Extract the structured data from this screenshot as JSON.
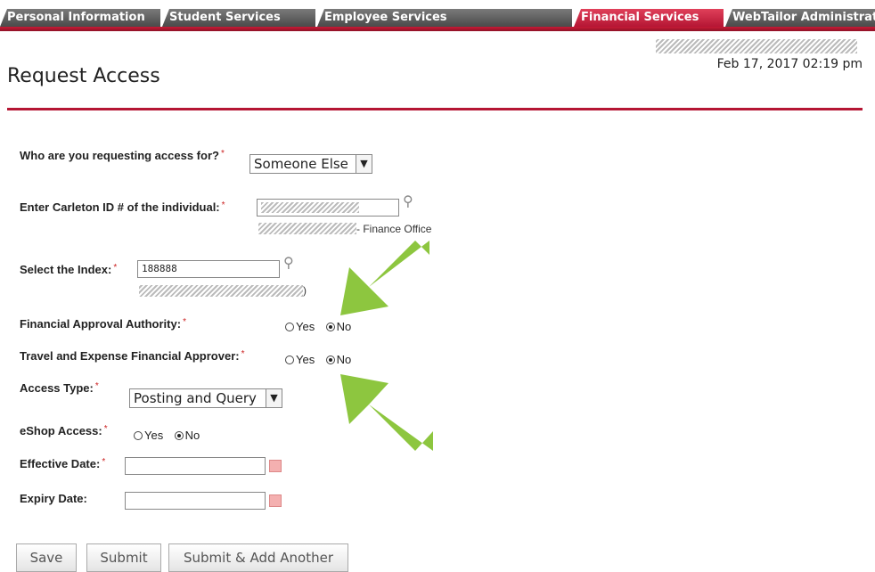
{
  "tabs": [
    {
      "label": "Personal Information",
      "active": false
    },
    {
      "label": "Student Services",
      "active": false
    },
    {
      "label": "Employee Services",
      "active": false
    },
    {
      "label": "Financial Services",
      "active": true
    },
    {
      "label": "WebTailor Administration",
      "active": false
    }
  ],
  "header": {
    "title": "Request Access",
    "date": "Feb 17, 2017 02:19 pm"
  },
  "form": {
    "requesting_for": {
      "label": "Who are you requesting access for?",
      "value": "Someone Else"
    },
    "carleton_id": {
      "label": "Enter Carleton ID # of the individual:",
      "sub": "- Finance Office"
    },
    "index": {
      "label": "Select the Index:",
      "value": "188888",
      "sub_suffix": ")"
    },
    "financial_approval": {
      "label": "Financial Approval Authority:",
      "selected": "No"
    },
    "travel_expense": {
      "label": "Travel and Expense Financial Approver:",
      "selected": "No"
    },
    "access_type": {
      "label": "Access Type:",
      "value": "Posting and Query"
    },
    "eshop": {
      "label": "eShop Access:",
      "selected": "No"
    },
    "effective_date": {
      "label": "Effective Date:",
      "value": ""
    },
    "expiry_date": {
      "label": "Expiry Date:",
      "value": ""
    },
    "yes_label": "Yes",
    "no_label": "No",
    "required_mark": "*"
  },
  "buttons": {
    "save": "Save",
    "submit": "Submit",
    "submit_add": "Submit & Add Another"
  },
  "colors": {
    "accent": "#b51634",
    "arrow": "#8dc63f"
  }
}
